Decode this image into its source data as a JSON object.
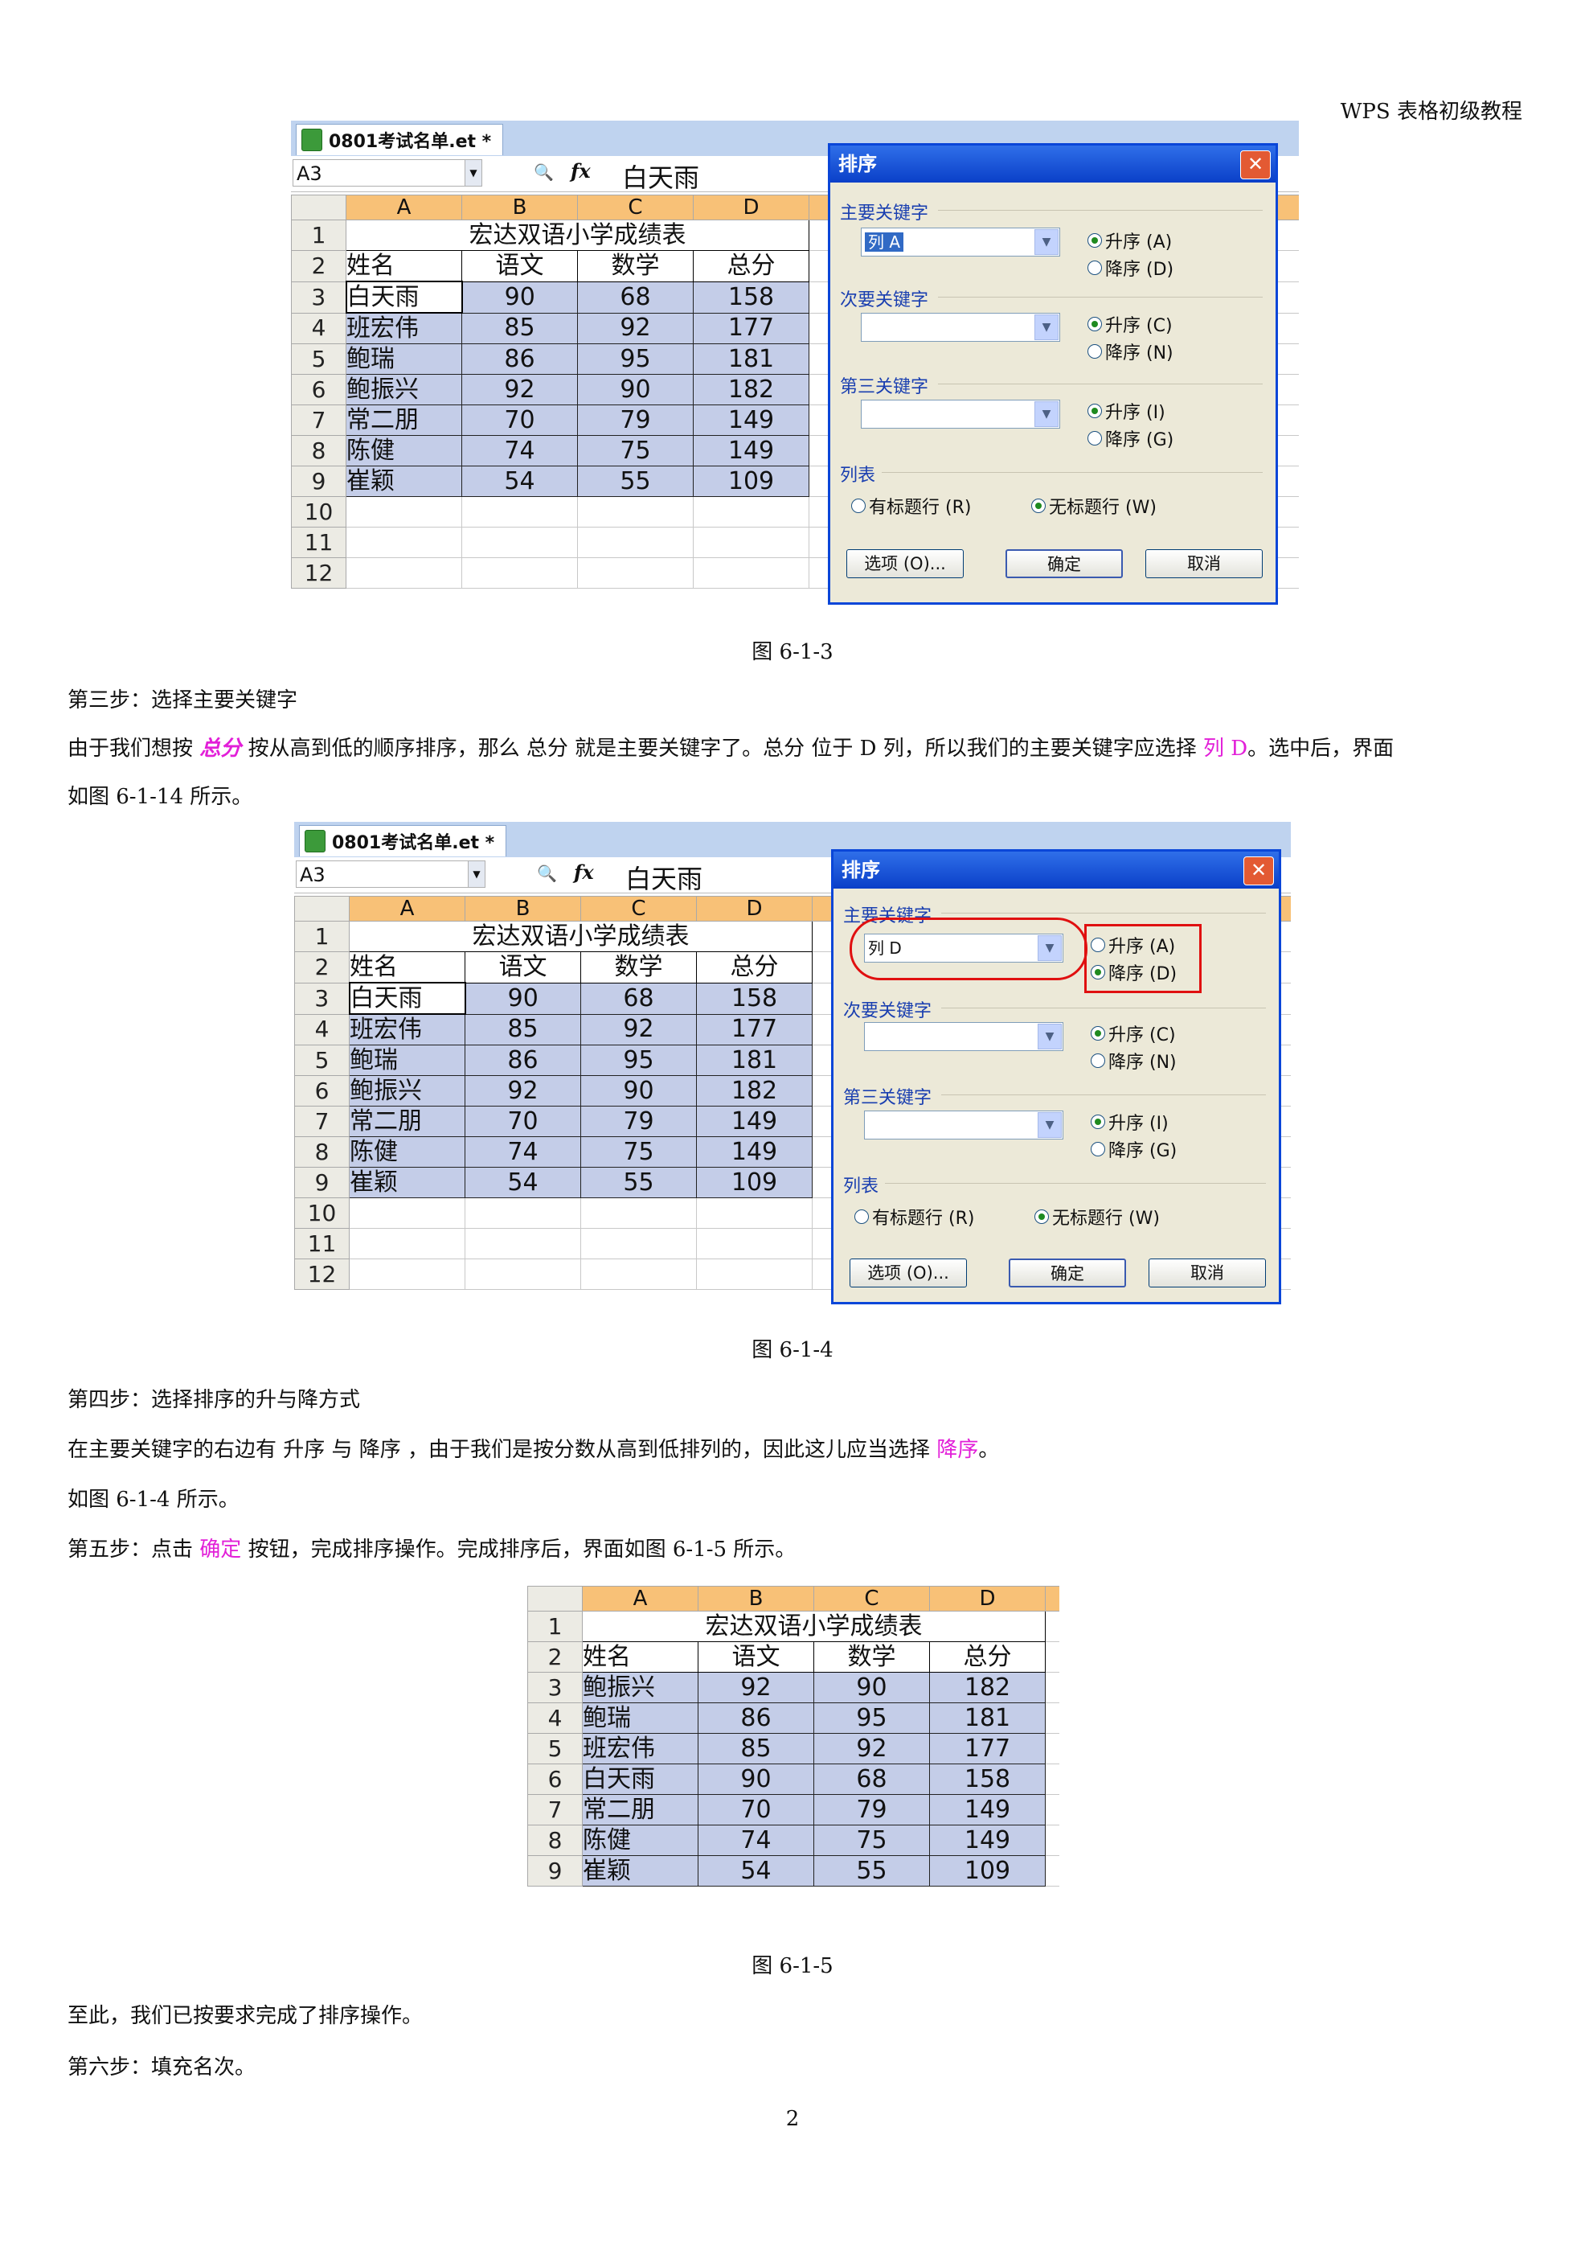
{
  "header": {
    "doc_title": "WPS 表格初级教程"
  },
  "spreadsheet": {
    "tab_name": "0801考试名单.et *",
    "name_box": "A3",
    "formula_value": "白天雨",
    "fx_symbol": "fx",
    "columns": [
      "A",
      "B",
      "C",
      "D"
    ],
    "table_title": "宏达双语小学成绩表",
    "headers": [
      "姓名",
      "语文",
      "数学",
      "总分"
    ],
    "rows_before": [
      [
        "白天雨",
        "90",
        "68",
        "158"
      ],
      [
        "班宏伟",
        "85",
        "92",
        "177"
      ],
      [
        "鲍瑞",
        "86",
        "95",
        "181"
      ],
      [
        "鲍振兴",
        "92",
        "90",
        "182"
      ],
      [
        "常二朋",
        "70",
        "79",
        "149"
      ],
      [
        "陈健",
        "74",
        "75",
        "149"
      ],
      [
        "崔颖",
        "54",
        "55",
        "109"
      ]
    ],
    "rows_after": [
      [
        "鲍振兴",
        "92",
        "90",
        "182"
      ],
      [
        "鲍瑞",
        "86",
        "95",
        "181"
      ],
      [
        "班宏伟",
        "85",
        "92",
        "177"
      ],
      [
        "白天雨",
        "90",
        "68",
        "158"
      ],
      [
        "常二朋",
        "70",
        "79",
        "149"
      ],
      [
        "陈健",
        "74",
        "75",
        "149"
      ],
      [
        "崔颖",
        "54",
        "55",
        "109"
      ]
    ],
    "row_numbers": [
      "1",
      "2",
      "3",
      "4",
      "5",
      "6",
      "7",
      "8",
      "9",
      "10",
      "11",
      "12"
    ]
  },
  "dialog": {
    "title": "排序",
    "close": "✕",
    "primary_key_label": "主要关键字",
    "secondary_key_label": "次要关键字",
    "third_key_label": "第三关键字",
    "list_label": "列表",
    "asc_a": "升序 (A)",
    "desc_d": "降序 (D)",
    "asc_c": "升序 (C)",
    "desc_n": "降序 (N)",
    "asc_i": "升序 (I)",
    "desc_g": "降序 (G)",
    "has_header": "有标题行 (R)",
    "no_header": "无标题行 (W)",
    "options_btn": "选项 (O)...",
    "ok_btn": "确定",
    "cancel_btn": "取消",
    "fig3_primary_value": "列 A",
    "fig4_primary_value": "列 D"
  },
  "captions": {
    "fig3": "图 6-1-3",
    "fig4": "图 6-1-4",
    "fig5": "图 6-1-5"
  },
  "text": {
    "step3_title": "第三步：选择主要关键字",
    "p1_a": "由于我们想按",
    "p1_b": "总分",
    "p1_c": "按从高到低的顺序排序，那么 总分 就是主要关键字了。总分 位于 D 列，所以我们的主要关键字应选择",
    "p1_d": "列 D",
    "p1_e": "。选中后，界面",
    "p1_f": "如图 6-1-14 所示。",
    "step4_title": "第四步：选择排序的升与降方式",
    "p2_a": "在主要关键字的右边有 升序 与 降序 ，由于我们是按分数从高到低排列的，因此这儿应当选择",
    "p2_b": "降序",
    "p2_c": "。",
    "p3": "如图 6-1-4 所示。",
    "p4_a": "第五步：点击",
    "p4_b": "确定",
    "p4_c": "按钮，完成排序操作。完成排序后，界面如图 6-1-5 所示。",
    "p5": "至此，我们已按要求完成了排序操作。",
    "step6_title": "第六步：填充名次。"
  },
  "page_number": "2",
  "colors": {
    "accent_pink": "#e21fd8",
    "selection_blue": "#c4cde8",
    "col_header_orange": "#f8c177",
    "dialog_border": "#0a46d8",
    "highlight_red": "#e01010"
  }
}
